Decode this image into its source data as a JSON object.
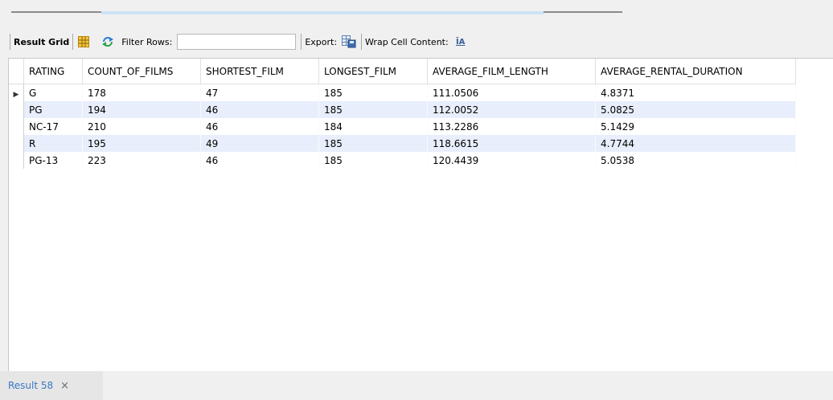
{
  "toolbar": {
    "result_grid_label": "Result Grid",
    "grid_icon": "grid-view-icon",
    "refresh_icon": "refresh-icon",
    "filter_label": "Filter Rows:",
    "filter_value": "",
    "export_label": "Export:",
    "export_icon": "export-icon",
    "wrap_label": "Wrap Cell Content:",
    "wrap_icon": "wrap-text-icon",
    "wrap_glyph": "ĪA"
  },
  "grid": {
    "columns": [
      "RATING",
      "COUNT_OF_FILMS",
      "SHORTEST_FILM",
      "LONGEST_FILM",
      "AVERAGE_FILM_LENGTH",
      "AVERAGE_RENTAL_DURATION"
    ],
    "rows": [
      [
        "G",
        "178",
        "47",
        "185",
        "111.0506",
        "4.8371"
      ],
      [
        "PG",
        "194",
        "46",
        "185",
        "112.0052",
        "5.0825"
      ],
      [
        "NC-17",
        "210",
        "46",
        "184",
        "113.2286",
        "5.1429"
      ],
      [
        "R",
        "195",
        "49",
        "185",
        "118.6615",
        "4.7744"
      ],
      [
        "PG-13",
        "223",
        "46",
        "185",
        "120.4439",
        "5.0538"
      ]
    ],
    "current_row_marker": "▶"
  },
  "bottom_tab": {
    "label": "Result 58",
    "close": "×"
  },
  "colors": {
    "alt_row": "#e8eefb",
    "tab_text": "#3a78c4"
  }
}
